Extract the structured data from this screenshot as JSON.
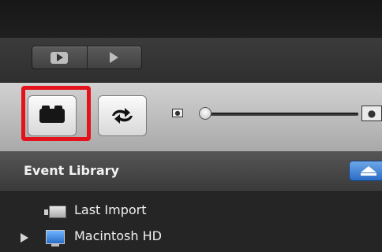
{
  "library": {
    "title": "Event Library"
  },
  "list": {
    "items": [
      {
        "label": "Last Import"
      },
      {
        "label": "Macintosh HD"
      }
    ]
  },
  "icons": {
    "playback_full": "play-fullscreen-icon",
    "playback": "play-icon",
    "camera": "camera-icon",
    "swap": "swap-icon",
    "thumb_small": "person-small-icon",
    "thumb_large": "person-large-icon",
    "eject": "eject-icon",
    "last_import": "import-icon",
    "disk": "hard-drive-icon"
  },
  "colors": {
    "highlight": "#e4121a",
    "accent_blue": "#2a6cc6"
  }
}
